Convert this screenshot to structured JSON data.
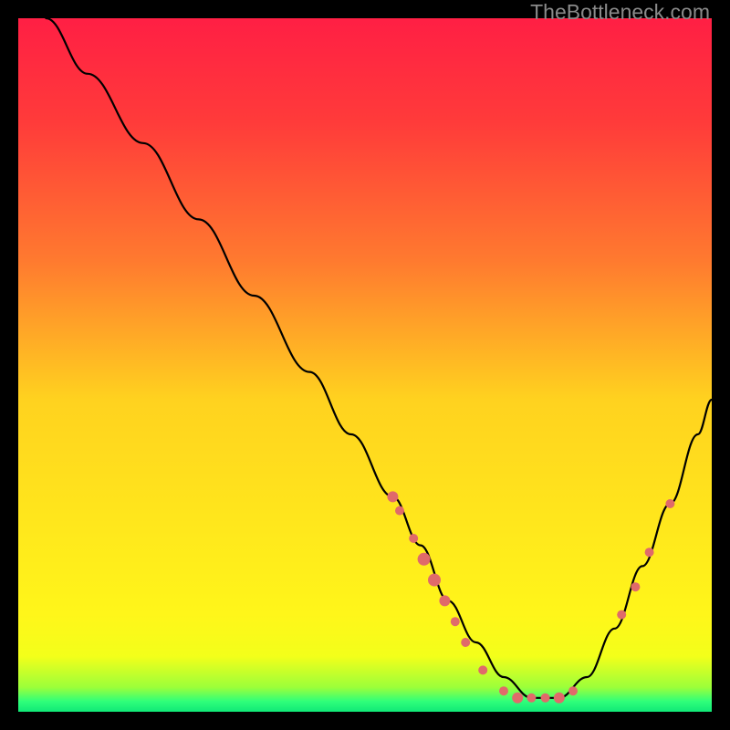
{
  "watermark": "TheBottleneck.com",
  "chart_data": {
    "type": "line",
    "title": "",
    "xlabel": "",
    "ylabel": "",
    "xlim": [
      0,
      100
    ],
    "ylim": [
      0,
      100
    ],
    "gradient_stops": [
      {
        "offset": 0.0,
        "color": "#ff1f44"
      },
      {
        "offset": 0.15,
        "color": "#ff3b3a"
      },
      {
        "offset": 0.35,
        "color": "#ff7a2f"
      },
      {
        "offset": 0.55,
        "color": "#ffd21f"
      },
      {
        "offset": 0.72,
        "color": "#ffe61c"
      },
      {
        "offset": 0.86,
        "color": "#fff61a"
      },
      {
        "offset": 0.92,
        "color": "#f3ff1a"
      },
      {
        "offset": 0.965,
        "color": "#9bff3a"
      },
      {
        "offset": 0.985,
        "color": "#2fff7a"
      },
      {
        "offset": 1.0,
        "color": "#10e877"
      }
    ],
    "series": [
      {
        "name": "bottleneck-curve",
        "x": [
          4,
          10,
          18,
          26,
          34,
          42,
          48,
          54,
          58,
          62,
          66,
          70,
          74,
          78,
          82,
          86,
          90,
          94,
          98,
          100
        ],
        "y": [
          100,
          92,
          82,
          71,
          60,
          49,
          40,
          31,
          24,
          16,
          10,
          5,
          2,
          2,
          5,
          12,
          21,
          30,
          40,
          45
        ]
      }
    ],
    "markers": {
      "name": "highlight-dots",
      "color": "#e06a6a",
      "points": [
        {
          "x": 54,
          "y": 31,
          "r": 6
        },
        {
          "x": 55,
          "y": 29,
          "r": 5
        },
        {
          "x": 57,
          "y": 25,
          "r": 5
        },
        {
          "x": 58.5,
          "y": 22,
          "r": 7
        },
        {
          "x": 60,
          "y": 19,
          "r": 7
        },
        {
          "x": 61.5,
          "y": 16,
          "r": 6
        },
        {
          "x": 63,
          "y": 13,
          "r": 5
        },
        {
          "x": 64.5,
          "y": 10,
          "r": 5
        },
        {
          "x": 67,
          "y": 6,
          "r": 5
        },
        {
          "x": 70,
          "y": 3,
          "r": 5
        },
        {
          "x": 72,
          "y": 2,
          "r": 6
        },
        {
          "x": 74,
          "y": 2,
          "r": 5
        },
        {
          "x": 76,
          "y": 2,
          "r": 5
        },
        {
          "x": 78,
          "y": 2,
          "r": 6
        },
        {
          "x": 80,
          "y": 3,
          "r": 5
        },
        {
          "x": 87,
          "y": 14,
          "r": 5
        },
        {
          "x": 89,
          "y": 18,
          "r": 5
        },
        {
          "x": 91,
          "y": 23,
          "r": 5
        },
        {
          "x": 94,
          "y": 30,
          "r": 5
        }
      ]
    }
  }
}
